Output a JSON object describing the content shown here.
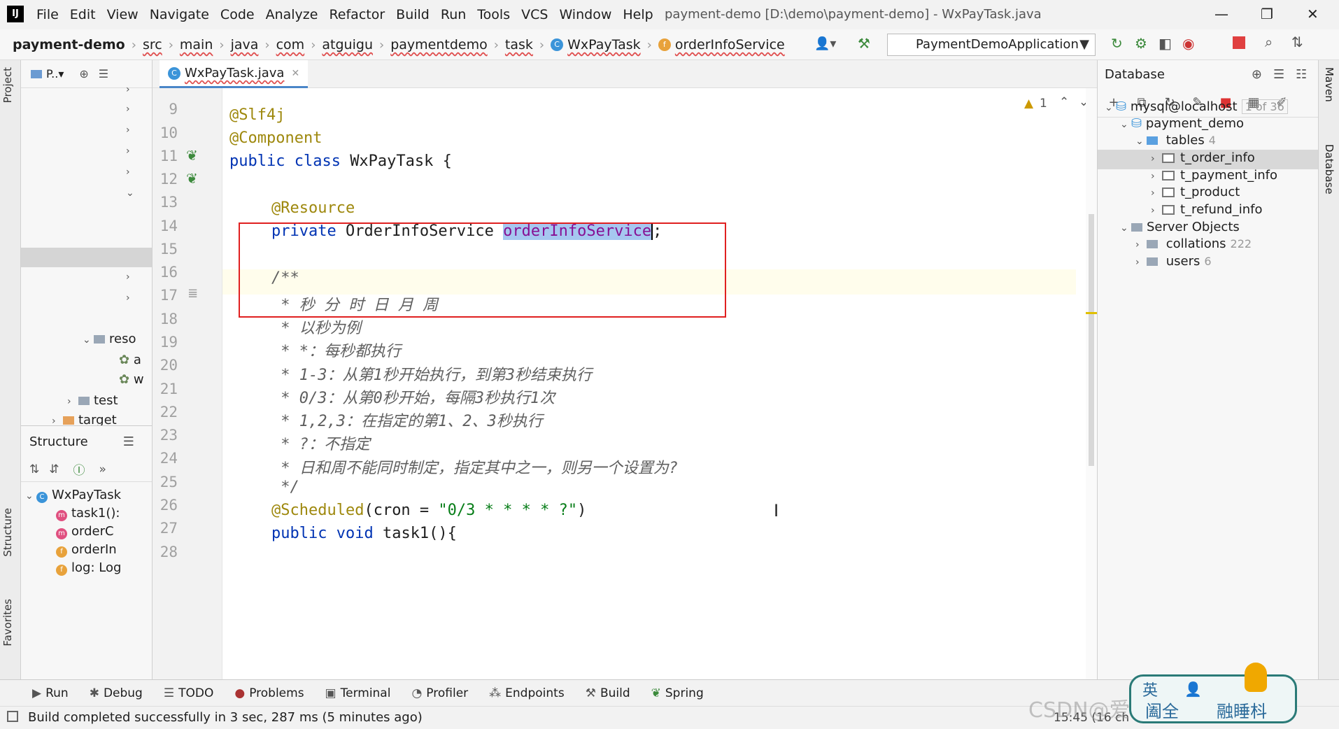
{
  "menubar": {
    "logo": "IJ",
    "items": [
      "File",
      "Edit",
      "View",
      "Navigate",
      "Code",
      "Analyze",
      "Refactor",
      "Build",
      "Run",
      "Tools",
      "VCS",
      "Window",
      "Help"
    ],
    "title": "payment-demo [D:\\demo\\payment-demo] - WxPayTask.java"
  },
  "breadcrumbs": [
    "payment-demo",
    "src",
    "main",
    "java",
    "com",
    "atguigu",
    "paymentdemo",
    "task",
    "WxPayTask",
    "orderInfoService"
  ],
  "run_config": "PaymentDemoApplication",
  "project": {
    "header": "P..▾",
    "rows": [
      {
        "label": "reso"
      },
      {
        "label": "a"
      },
      {
        "label": "w"
      },
      {
        "label": "test"
      },
      {
        "label": "target"
      }
    ]
  },
  "structure": {
    "header": "Structure",
    "root": "WxPayTask",
    "members": [
      {
        "badge": "m",
        "label": "task1():"
      },
      {
        "badge": "m",
        "label": "orderC"
      },
      {
        "badge": "f",
        "label": "orderIn"
      },
      {
        "badge": "f",
        "label": "log: Log"
      }
    ]
  },
  "left_tabs": {
    "project": "Project",
    "structure": "Structure",
    "favorites": "Favorites"
  },
  "right_tabs": {
    "maven": "Maven",
    "database": "Database"
  },
  "editor": {
    "tab_label": "WxPayTask.java",
    "warning_count": "1",
    "line_numbers": [
      "9",
      "10",
      "11",
      "12",
      "13",
      "14",
      "15",
      "16",
      "17",
      "18",
      "19",
      "20",
      "21",
      "22",
      "23",
      "24",
      "25",
      "26",
      "27",
      "28"
    ],
    "lines": {
      "l10": "@Slf4j",
      "l11": "@Component",
      "l12_kw": "public class ",
      "l12_rest": "WxPayTask {",
      "l14": "@Resource",
      "l15_kw": "private ",
      "l15_type": "OrderInfoService ",
      "l15_sel": "orderInfoService",
      "l15_end": ";",
      "l17": "/**",
      "l18": " * 秒 分 时 日 月 周",
      "l19": " * 以秒为例",
      "l20": " * *：每秒都执行",
      "l21": " * 1-3：从第1秒开始执行，到第3秒结束执行",
      "l22": " * 0/3：从第0秒开始，每隔3秒执行1次",
      "l23": " * 1,2,3：在指定的第1、2、3秒执行",
      "l24": " * ?：不指定",
      "l25": " * 日和周不能同时制定，指定其中之一，则另一个设置为?",
      "l26": " */",
      "l27_anno": "@Scheduled",
      "l27_open": "(cron = ",
      "l27_str": "\"0/3 * * * * ?\"",
      "l27_close": ")",
      "l28_kw": "public void ",
      "l28_rest": "task1(){"
    }
  },
  "database": {
    "header": "Database",
    "rows": {
      "conn": "mysql@localhost",
      "conn_count": "1 of 36",
      "schema": "payment_demo",
      "tables": "tables",
      "tables_count": "4",
      "t1": "t_order_info",
      "t2": "t_payment_info",
      "t3": "t_product",
      "t4": "t_refund_info",
      "server": "Server Objects",
      "collations": "collations",
      "collations_count": "222",
      "users": "users",
      "users_count": "6"
    }
  },
  "tool_windows": [
    "Run",
    "Debug",
    "TODO",
    "Problems",
    "Terminal",
    "Profiler",
    "Endpoints",
    "Build",
    "Spring"
  ],
  "status": {
    "message": "Build completed successfully in 3 sec, 287 ms (5 minutes ago)",
    "position": "15:45 (16 ch"
  },
  "watermark": "CSDN@爱你三千遍斯塔克",
  "ime": {
    "lang": "英",
    "text": "阖全",
    "label": "融睡枓"
  },
  "colors": {
    "accent": "#4a86c8",
    "highlight_box": "#e02020",
    "selection": "#a6c7f0"
  }
}
